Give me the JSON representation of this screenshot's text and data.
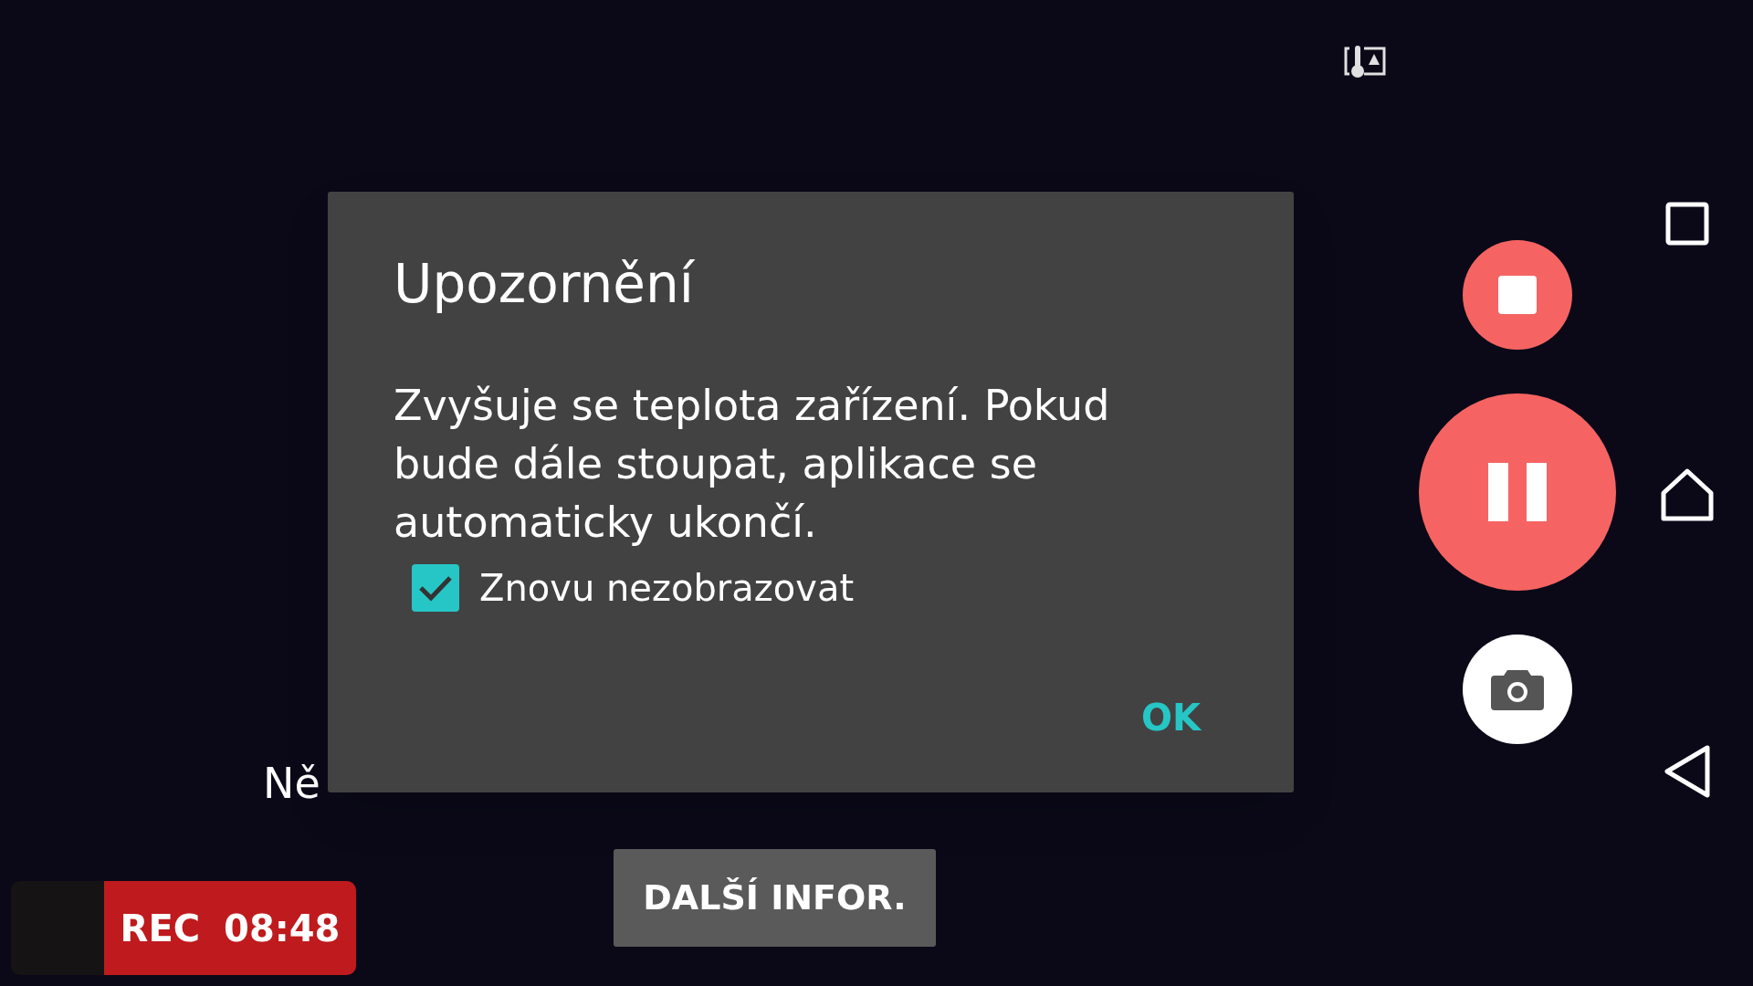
{
  "notice": {
    "text": "Ně"
  },
  "more_info_button": {
    "label": "DALŠÍ INFOR."
  },
  "recording": {
    "label": "REC",
    "time": "08:48"
  },
  "dialog": {
    "title": "Upozornění",
    "message": "Zvyšuje se teplota zařízení. Pokud bude dále stoupat, aplikace se automaticky ukončí.",
    "checkbox": {
      "label": "Znovu nezobrazovat",
      "checked": true
    },
    "button": "OK"
  }
}
